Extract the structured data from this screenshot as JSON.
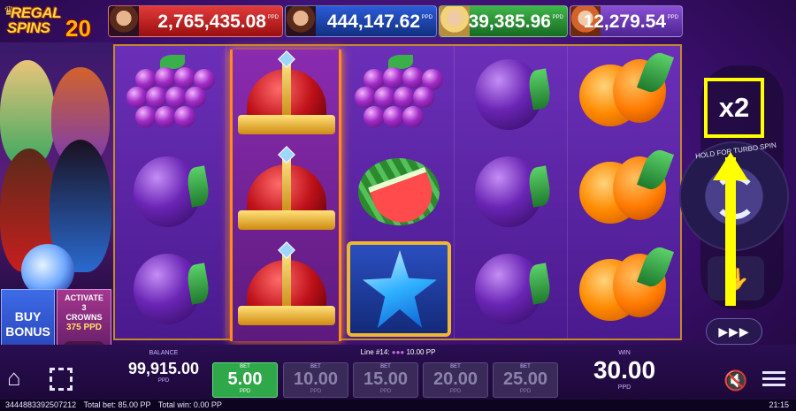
{
  "logo": {
    "line1": "REGAL",
    "line2": "SPINS",
    "number": "20"
  },
  "jackpots": [
    {
      "value": "2,765,435.08",
      "unit": "PPD",
      "color": "#e23a3a"
    },
    {
      "value": "444,147.62",
      "unit": "PPD",
      "color": "#2a5bd8"
    },
    {
      "value": "39,385.96",
      "unit": "PPD",
      "color": "#3fb54a"
    },
    {
      "value": "12,279.54",
      "unit": "PPD",
      "color": "#8a4fd6"
    }
  ],
  "left": {
    "buy_bonus": [
      "BUY",
      "BONUS"
    ],
    "activate": [
      "ACTIVATE",
      "3",
      "CROWNS",
      "375 PPD"
    ],
    "toggle_off": "✕",
    "toggle_on": "✓"
  },
  "reels": {
    "columns": [
      [
        "grapes",
        "plum",
        "plum"
      ],
      [
        "crown",
        "crown",
        "crown"
      ],
      [
        "grapes",
        "watermelon",
        "blue-star"
      ],
      [
        "plum",
        "plum",
        "plum"
      ],
      [
        "orange",
        "orange",
        "orange"
      ]
    ]
  },
  "controls": {
    "multiplier": "x2",
    "hold_text": "HOLD FOR TURBO SPIN",
    "ffwd": "▶▶▶"
  },
  "bottom": {
    "balance_label": "BALANCE",
    "balance_value": "99,915.00",
    "balance_unit": "PPD",
    "line_text": "Line #14:",
    "line_win": "10.00 PP",
    "bets": [
      {
        "label": "BET",
        "value": "5.00",
        "unit": "PPD",
        "active": true
      },
      {
        "label": "BET",
        "value": "10.00",
        "unit": "PPD",
        "active": false
      },
      {
        "label": "BET",
        "value": "15.00",
        "unit": "PPD",
        "active": false
      },
      {
        "label": "BET",
        "value": "20.00",
        "unit": "PPD",
        "active": false
      },
      {
        "label": "BET",
        "value": "25.00",
        "unit": "PPD",
        "active": false
      }
    ],
    "win_label": "WIN",
    "win_value": "30.00",
    "win_unit": "PPD"
  },
  "status": {
    "id": "3444883392507212",
    "total_bet": "Total bet: 85.00 PP",
    "total_win": "Total win: 0.00 PP",
    "time": "21:15"
  }
}
